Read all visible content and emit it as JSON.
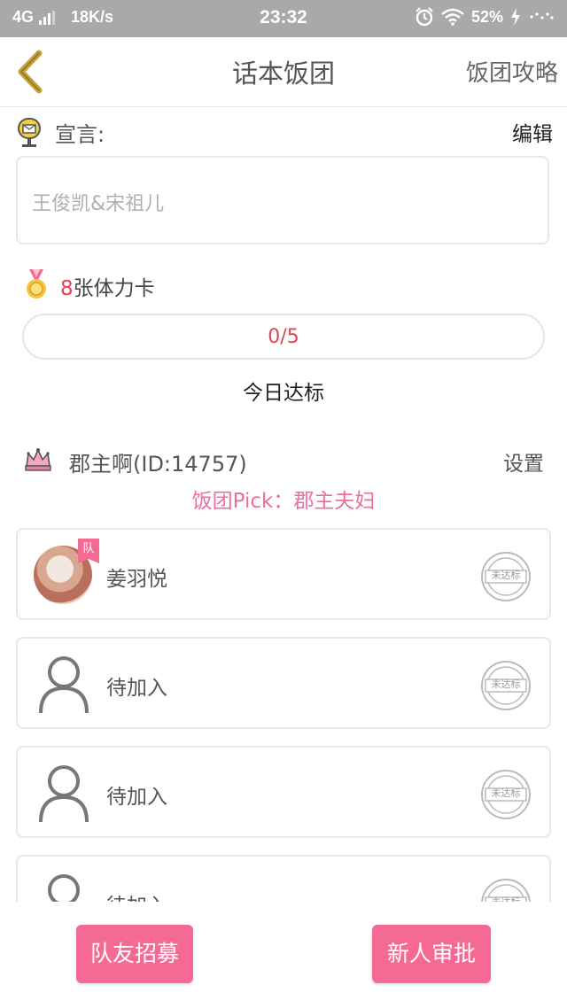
{
  "status_bar": {
    "network": "4G",
    "speed": "18K/s",
    "time": "23:32",
    "battery": "52%",
    "icons": [
      "signal-icon",
      "alarm-icon",
      "wifi-icon",
      "charging-icon"
    ]
  },
  "nav": {
    "title": "话本饭团",
    "right_link": "饭团攻略",
    "back_icon": "chevron-left-icon"
  },
  "declaration": {
    "label": "宣言:",
    "edit_label": "编辑",
    "text": "王俊凯&宋祖儿"
  },
  "stamina": {
    "count": "8",
    "suffix": "张体力卡"
  },
  "progress": {
    "text": "0/5",
    "fraction": 0,
    "caption": "今日达标"
  },
  "team": {
    "leader": "郡主啊(ID:14757)",
    "settings_label": "设置",
    "pick": "饭团Pick：郡主夫妇"
  },
  "members": [
    {
      "name": "姜羽悦",
      "badge": "队",
      "status": "未达标",
      "has_avatar": true
    },
    {
      "name": "待加入",
      "status": "未达标",
      "has_avatar": false
    },
    {
      "name": "待加入",
      "status": "未达标",
      "has_avatar": false
    },
    {
      "name": "待加入",
      "status": "未达标",
      "has_avatar": false
    }
  ],
  "buttons": {
    "recruit": "队友招募",
    "approve": "新人审批"
  },
  "colors": {
    "accent_pink": "#f56a95",
    "highlight_red": "#e04458",
    "pick_pink": "#ea6fa0",
    "status_bar_gray": "#a9a9a9",
    "back_arrow_gold": "#c9a23a"
  }
}
